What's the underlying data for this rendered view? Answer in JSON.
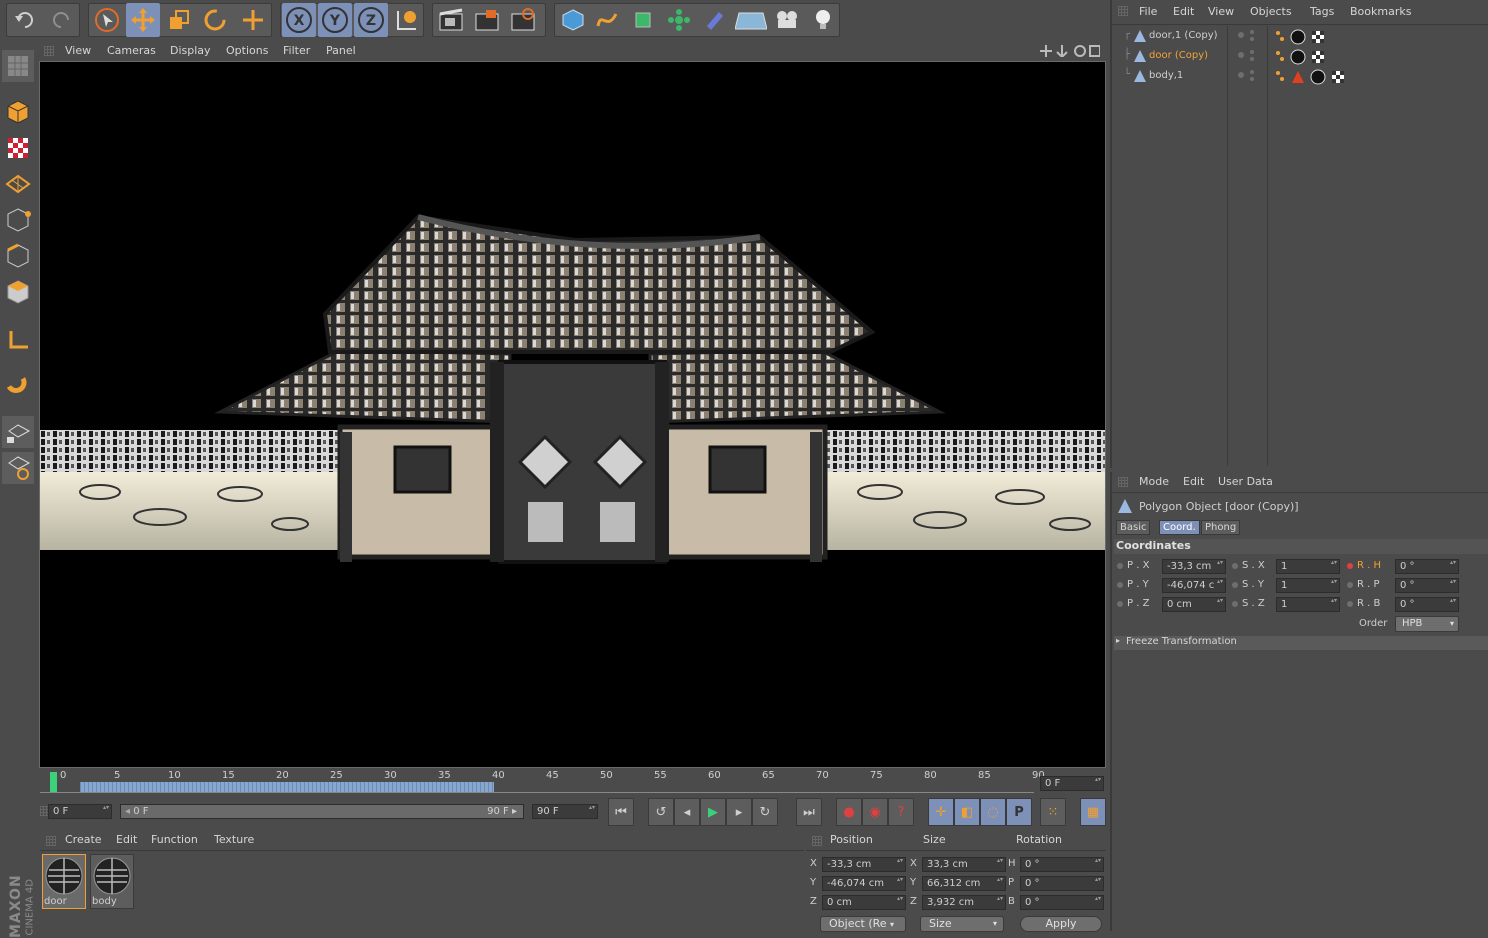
{
  "toolbar": {
    "icons": [
      "undo-icon",
      "redo-icon",
      "select-icon",
      "move-icon",
      "scale-icon",
      "rotate-icon",
      "add-icon",
      "x-axis-icon",
      "y-axis-icon",
      "z-axis-icon",
      "world-coord-icon",
      "render-view-icon",
      "render-picture-icon",
      "render-settings-icon",
      "cube-icon",
      "spline-icon",
      "nurbs-icon",
      "array-icon",
      "deformer-icon",
      "scene-icon",
      "camera-icon",
      "light-icon"
    ]
  },
  "viewport": {
    "menu": [
      "View",
      "Cameras",
      "Display",
      "Options",
      "Filter",
      "Panel"
    ]
  },
  "timeline": {
    "ticks": [
      "0",
      "5",
      "10",
      "15",
      "20",
      "25",
      "30",
      "35",
      "40",
      "45",
      "50",
      "55",
      "60",
      "65",
      "70",
      "75",
      "80",
      "85",
      "90"
    ],
    "current_frame": "0 F"
  },
  "transport": {
    "start": "0 F",
    "range_start": "0 F",
    "range_end": "90 F",
    "end": "90 F"
  },
  "material": {
    "menu": [
      "Create",
      "Edit",
      "Function",
      "Texture"
    ],
    "items": [
      "door",
      "body"
    ]
  },
  "coords": {
    "headers": [
      "Position",
      "Size",
      "Rotation"
    ],
    "rows": [
      {
        "axis": "X",
        "pos": "-33,3 cm",
        "size_axis": "X",
        "size": "33,3 cm",
        "rot_axis": "H",
        "rot": "0 °"
      },
      {
        "axis": "Y",
        "pos": "-46,074 cm",
        "size_axis": "Y",
        "size": "66,312 cm",
        "rot_axis": "P",
        "rot": "0 °"
      },
      {
        "axis": "Z",
        "pos": "0 cm",
        "size_axis": "Z",
        "size": "3,932 cm",
        "rot_axis": "B",
        "rot": "0 °"
      }
    ],
    "mode": "Object (Re",
    "size_mode": "Size",
    "apply": "Apply"
  },
  "objects": {
    "menu": [
      "File",
      "Edit",
      "View",
      "Objects",
      "Tags",
      "Bookmarks"
    ],
    "items": [
      {
        "name": "door,1 (Copy)",
        "selected": false
      },
      {
        "name": "door (Copy)",
        "selected": true
      },
      {
        "name": "body,1",
        "selected": false
      }
    ]
  },
  "attributes": {
    "menu": [
      "Mode",
      "Edit",
      "User Data"
    ],
    "title": "Polygon Object [door (Copy)]",
    "tabs": [
      "Basic",
      "Coord.",
      "Phong"
    ],
    "section": "Coordinates",
    "rows": [
      {
        "p_label": "P . X",
        "p": "-33,3 cm",
        "s_label": "S . X",
        "s": "1",
        "r_label": "R . H",
        "r": "0 °"
      },
      {
        "p_label": "P . Y",
        "p": "-46,074 c",
        "s_label": "S . Y",
        "s": "1",
        "r_label": "R . P",
        "r": "0 °"
      },
      {
        "p_label": "P . Z",
        "p": "0 cm",
        "s_label": "S . Z",
        "s": "1",
        "r_label": "R . B",
        "r": "0 °"
      }
    ],
    "order_label": "Order",
    "order": "HPB",
    "freeze": "Freeze Transformation"
  },
  "brand": {
    "line1": "MAXON",
    "line2": "CINEMA 4D"
  },
  "colors": {
    "accent": "#7d90b8",
    "orange": "#f0a030",
    "selected_text": "#f3a23a"
  }
}
